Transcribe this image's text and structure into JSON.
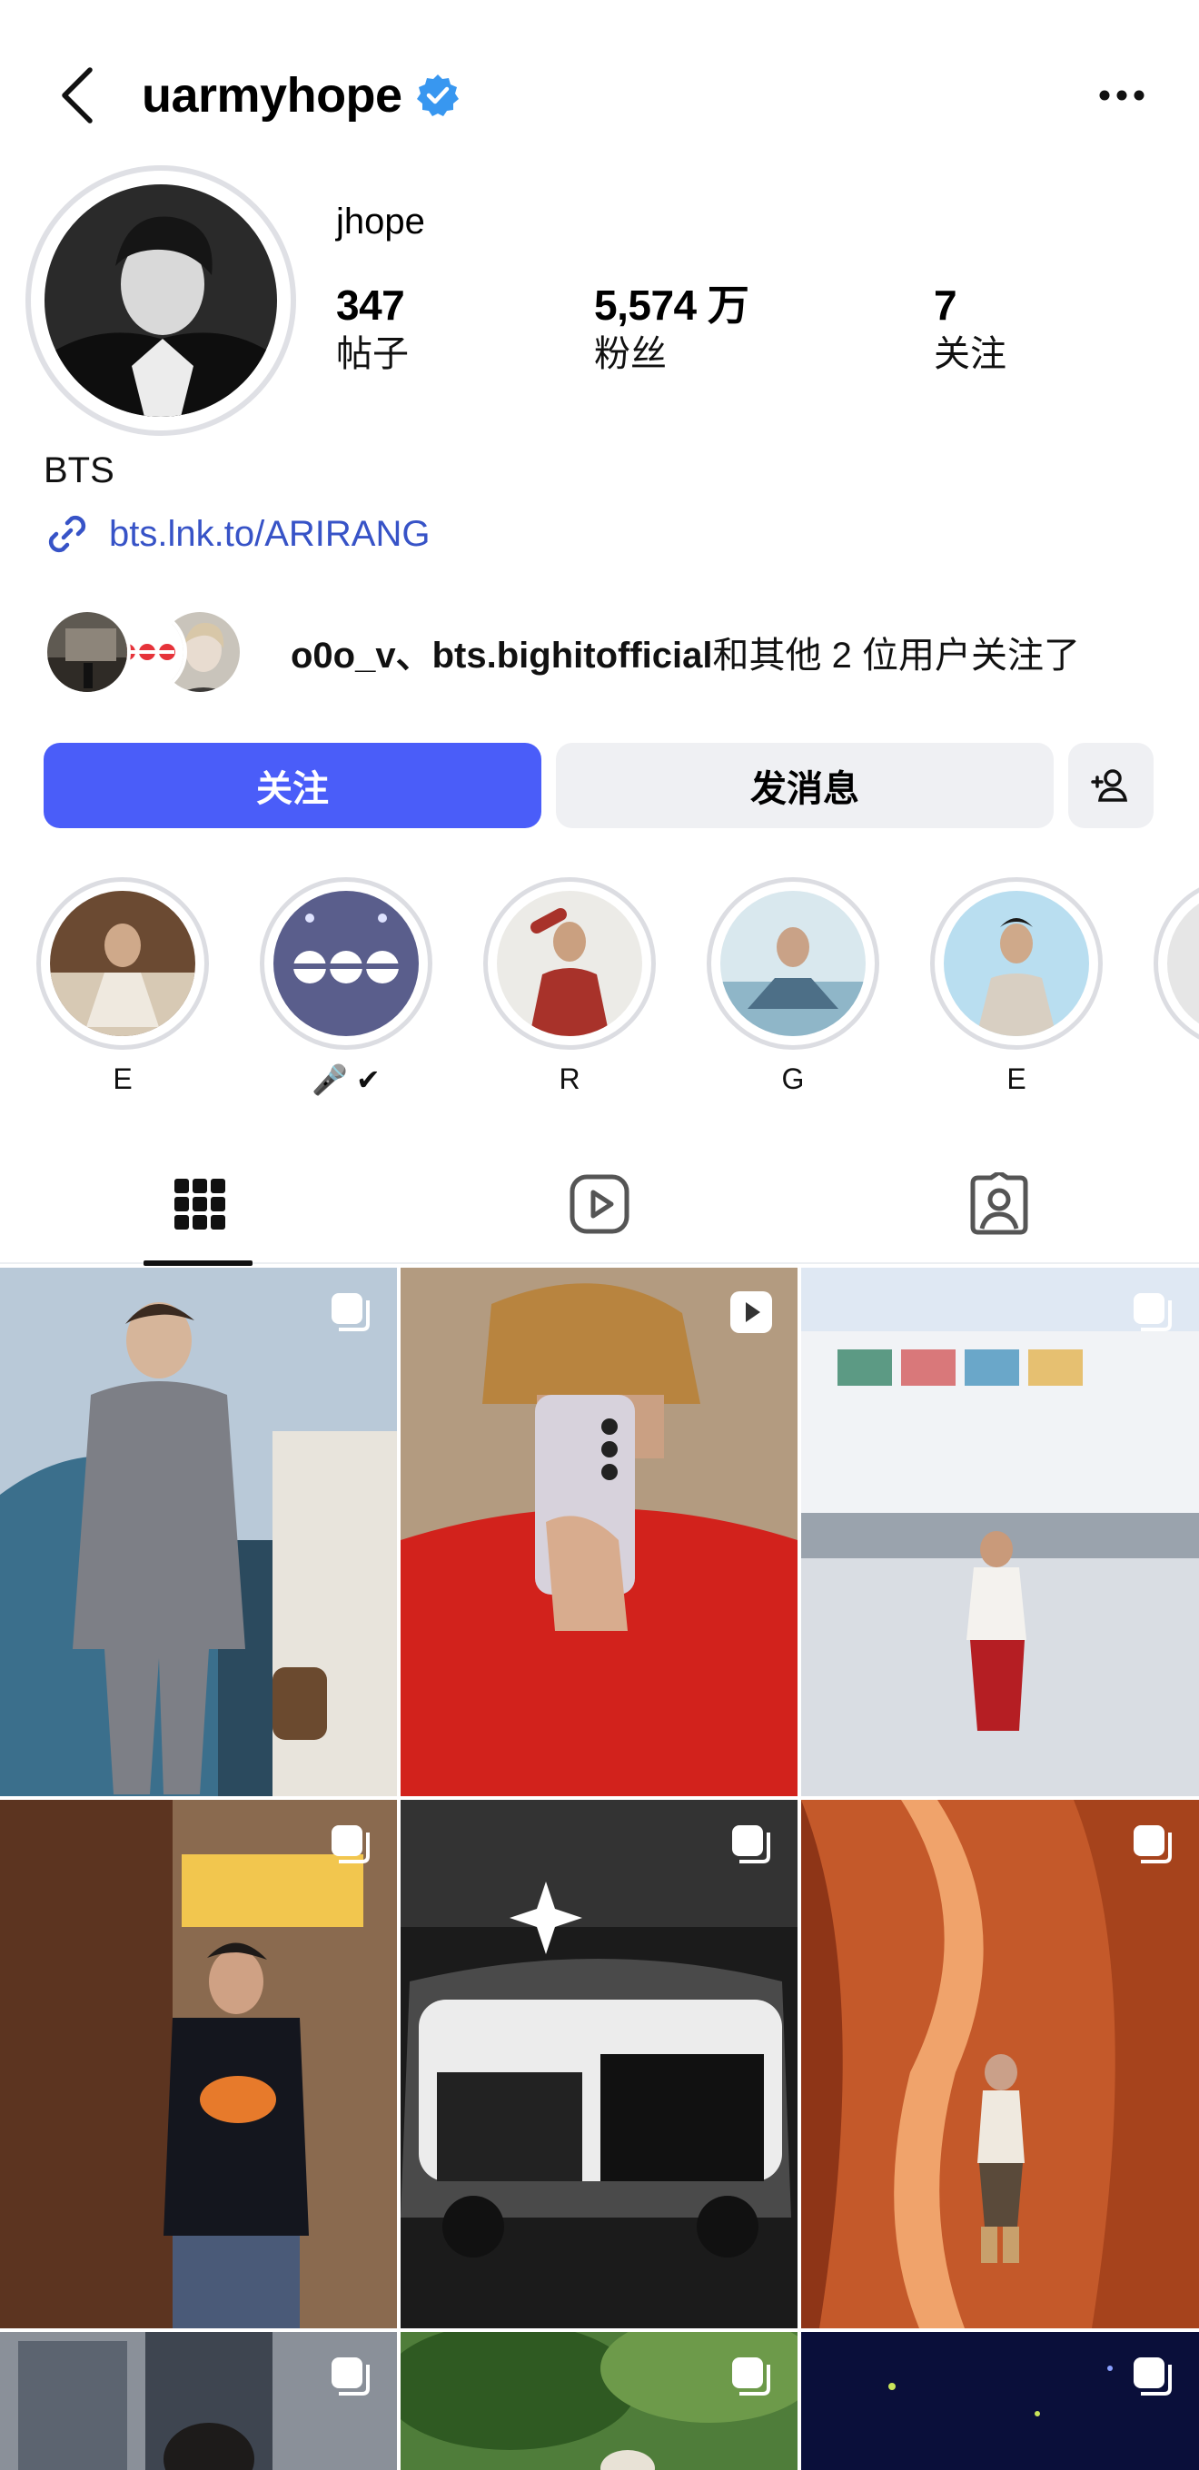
{
  "profile": {
    "username": "uarmyhope",
    "verified": true,
    "display_name": "jhope",
    "stats": [
      {
        "value": "347",
        "label": "帖子"
      },
      {
        "value": "5,574 万",
        "label": "粉丝"
      },
      {
        "value": "7",
        "label": "关注"
      }
    ],
    "bio": "BTS",
    "link": "bts.lnk.to/ARIRANG"
  },
  "followed_by": {
    "users": "o0o_v、bts.bighitofficial",
    "suffix": "和其他 2 位用户关注了"
  },
  "actions": {
    "follow_label": "关注",
    "message_label": "发消息"
  },
  "highlights": [
    {
      "label": "E"
    },
    {
      "label": "🎤 ✔"
    },
    {
      "label": "R"
    },
    {
      "label": "G"
    },
    {
      "label": "E"
    }
  ],
  "tabs": [
    {
      "icon": "grid-icon",
      "active": true
    },
    {
      "icon": "reels-icon",
      "active": false
    },
    {
      "icon": "tagged-icon",
      "active": false
    }
  ],
  "colors": {
    "accent": "#4a5df9",
    "link": "#3753c7",
    "verified": "#3897f0",
    "secondary_button": "#eff0f3"
  }
}
